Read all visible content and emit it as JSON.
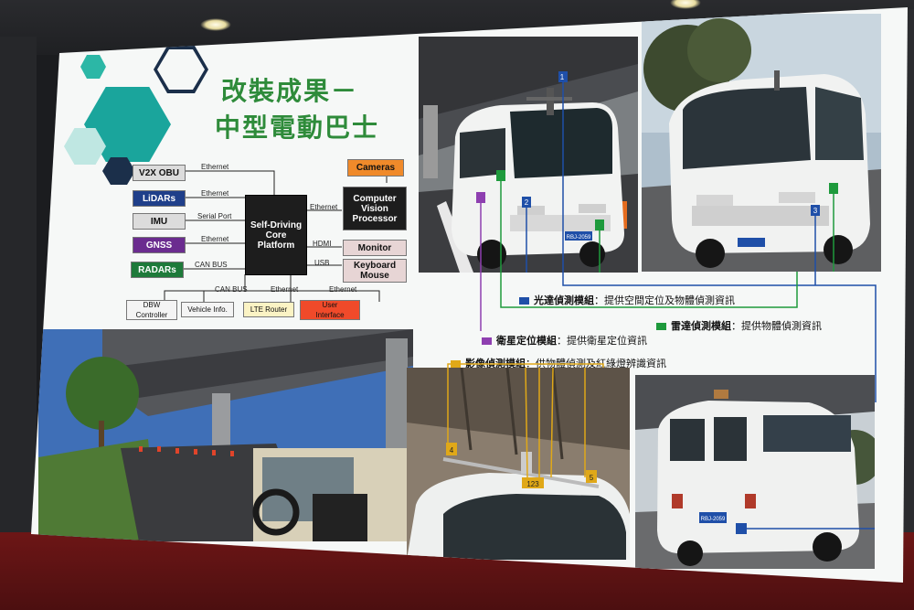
{
  "slide": {
    "title_line1": "改裝成果－",
    "title_line2": "中型電動巴士",
    "diagram": {
      "core": "Self-Driving\nCore\nPlatform",
      "left_boxes": [
        "V2X OBU",
        "LiDARs",
        "IMU",
        "GNSS",
        "RADARs"
      ],
      "left_links": [
        "Ethernet",
        "Ethernet",
        "Serial Port",
        "Ethernet",
        "CAN BUS"
      ],
      "right_boxes": [
        "Cameras",
        "Computer\nVision\nProcessor",
        "Monitor",
        "Keyboard\nMouse"
      ],
      "right_links": [
        "Ethernet",
        "HDMI",
        "USB"
      ],
      "bottom_boxes": [
        "DBW\nController",
        "Vehicle Info.",
        "LTE Router",
        "User\nInterface"
      ],
      "bottom_links": [
        "CAN BUS",
        "Ethernet",
        "Ethernet"
      ]
    },
    "captions": [
      {
        "label": "光達偵測模組",
        "text": "：提供空間定位及物體偵測資訊",
        "color": "#1f4fa8"
      },
      {
        "label": "雷達偵測模組",
        "text": "：提供物體偵測資訊",
        "color": "#1e9a3c"
      },
      {
        "label": "衛星定位模組",
        "text": "：提供衛星定位資訊",
        "color": "#8e3fb0"
      },
      {
        "label": "影像偵測模組",
        "text": "：供物體偵測及紅綠燈辨識資訊",
        "color": "#e0a818"
      }
    ],
    "plates": {
      "front": "RBJ-2059",
      "rear": "RBJ-2059"
    },
    "markers": [
      "1",
      "2",
      "3",
      "4",
      "5",
      "123"
    ]
  },
  "colors": {
    "title_green": "#2e8b3a",
    "teal": "#1aa59c",
    "navy": "#1b2f4a"
  }
}
